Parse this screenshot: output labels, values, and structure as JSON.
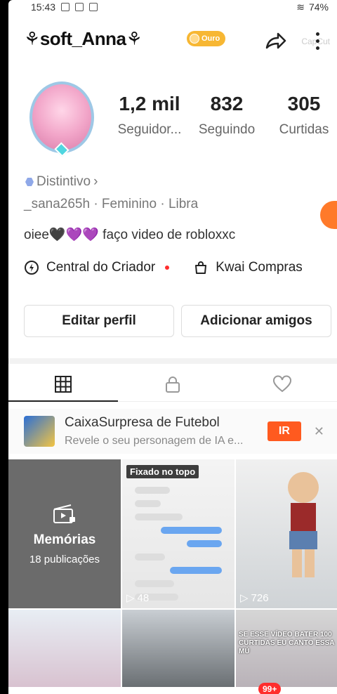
{
  "status": {
    "time": "15:43",
    "battery": "74%"
  },
  "header": {
    "username": "soft_Anna",
    "badge": "Ouro",
    "watermark": "CapCut"
  },
  "stats": [
    {
      "value": "1,2 mil",
      "label": "Seguidor..."
    },
    {
      "value": "832",
      "label": "Seguindo"
    },
    {
      "value": "305",
      "label": "Curtidas"
    }
  ],
  "profile": {
    "distintivo": "Distintivo",
    "meta": "_sana265h · Feminino · Libra",
    "bio": "oiee🖤💜💜 faço video de robloxxc"
  },
  "links": {
    "creator": "Central do Criador",
    "shop": "Kwai Compras"
  },
  "buttons": {
    "edit": "Editar perfil",
    "add": "Adicionar amigos"
  },
  "ad": {
    "title": "CaixaSurpresa de Futebol",
    "subtitle": "Revele o seu personagem de IA e...",
    "cta": "IR"
  },
  "grid": {
    "memories_title": "Memórias",
    "memories_sub": "18 publicações",
    "pinned": "Fixado no topo",
    "views_1": "48",
    "views_2": "726",
    "overlay_text": "SE ESSE VÍDEO BATER 100 CURTIDAS EU CANTO ESSA MÚ"
  },
  "nav": {
    "notifications": "99+"
  },
  "colors": {
    "accent": "#ff5a1f",
    "gold": "#f7b733",
    "notification": "#ff2d2d"
  }
}
